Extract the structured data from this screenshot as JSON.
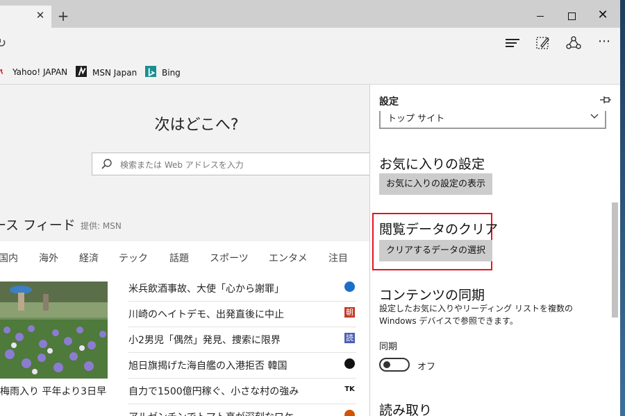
{
  "tab": {
    "close_glyph": "✕"
  },
  "new_tab_glyph": "+",
  "window": {
    "minimize": "",
    "maximize": "",
    "close_glyph": "✕"
  },
  "nav": {
    "more_glyph": "⋯"
  },
  "favorites": [
    {
      "label": "Yahoo! JAPAN",
      "icon": "yahoo-icon"
    },
    {
      "label": "MSN Japan",
      "icon": "msn-icon"
    },
    {
      "label": "Bing",
      "icon": "bing-icon"
    }
  ],
  "newtab": {
    "heading": "次はどこへ?",
    "search_placeholder": "検索または Web アドレスを入力",
    "feed_title": "ース フィード",
    "feed_source": "提供: MSN",
    "categories": [
      "国内",
      "海外",
      "経済",
      "テック",
      "話題",
      "スポーツ",
      "エンタメ",
      "注目"
    ],
    "photo_caption": "梅雨入り 平年より3日早",
    "news": [
      {
        "title": "米兵飲酒事故、大使「心から謝罪」",
        "badge": "",
        "badge_color": "#1a6fc9"
      },
      {
        "title": "川崎のヘイトデモ、出発直後に中止",
        "badge": "朝",
        "badge_color": "#c0392b"
      },
      {
        "title": "小2男児「偶然」発見、捜索に限界",
        "badge": "読",
        "badge_color": "#4a5fb0"
      },
      {
        "title": "旭日旗揭げた海自艦の入港拒否 韓国",
        "badge": "",
        "badge_color": "#111111"
      },
      {
        "title": "自力で1500億円稼ぐ、小さな村の強み",
        "badge": "TK",
        "badge_color": "#ffffff"
      },
      {
        "title": "アルゼンチンでトマト高が深刻なワケ",
        "badge": "",
        "badge_color": "#d35400"
      }
    ]
  },
  "settings": {
    "title": "設定",
    "dropdown_value": "トップ サイト",
    "favorites_heading": "お気に入りの設定",
    "favorites_button": "お気に入りの設定の表示",
    "clear_heading": "閲覧データのクリア",
    "clear_button": "クリアするデータの選択",
    "sync_heading": "コンテンツの同期",
    "sync_desc": "設定したお気に入りやリーディング リストを複数の Windows デバイスで参照できます。",
    "sync_label": "同期",
    "sync_state": "オフ",
    "reading_heading": "読み取り"
  },
  "colors": {
    "highlight": "#e81123",
    "panel_bg": "#ffffff",
    "chrome": "#f2f2f2"
  }
}
